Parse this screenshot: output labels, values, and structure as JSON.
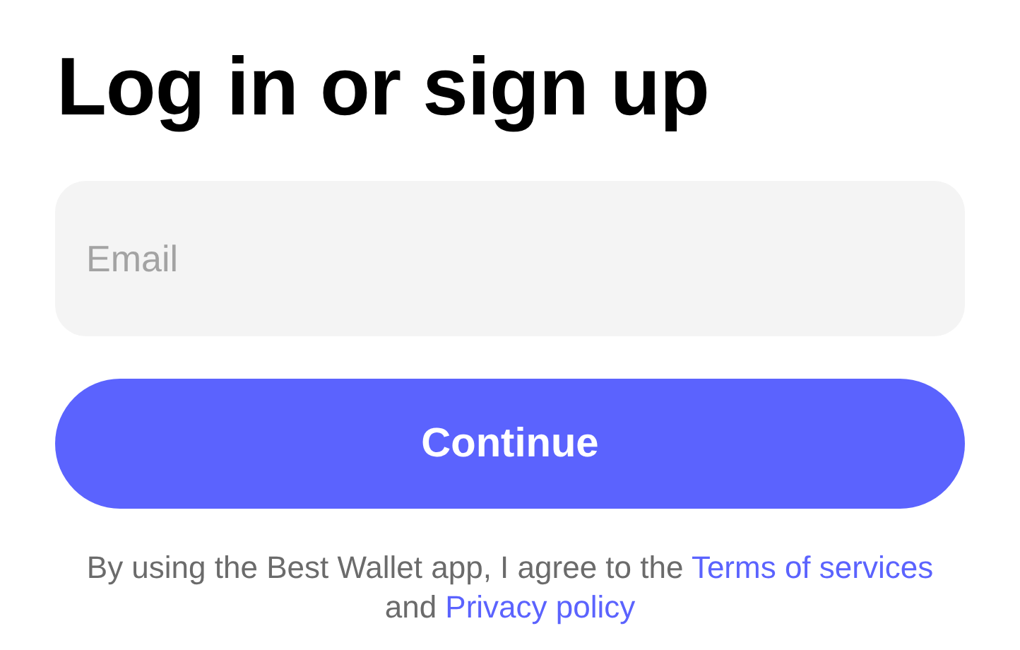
{
  "title": "Log in or sign up",
  "email_field": {
    "placeholder": "Email"
  },
  "continue_button": {
    "label": "Continue"
  },
  "legal": [
    {
      "kind": "text",
      "text": "By using the Best Wallet app, I agree to the "
    },
    {
      "kind": "link",
      "text": "Terms of services"
    },
    {
      "kind": "text",
      "text": " and "
    },
    {
      "kind": "link",
      "text": "Privacy policy"
    }
  ]
}
